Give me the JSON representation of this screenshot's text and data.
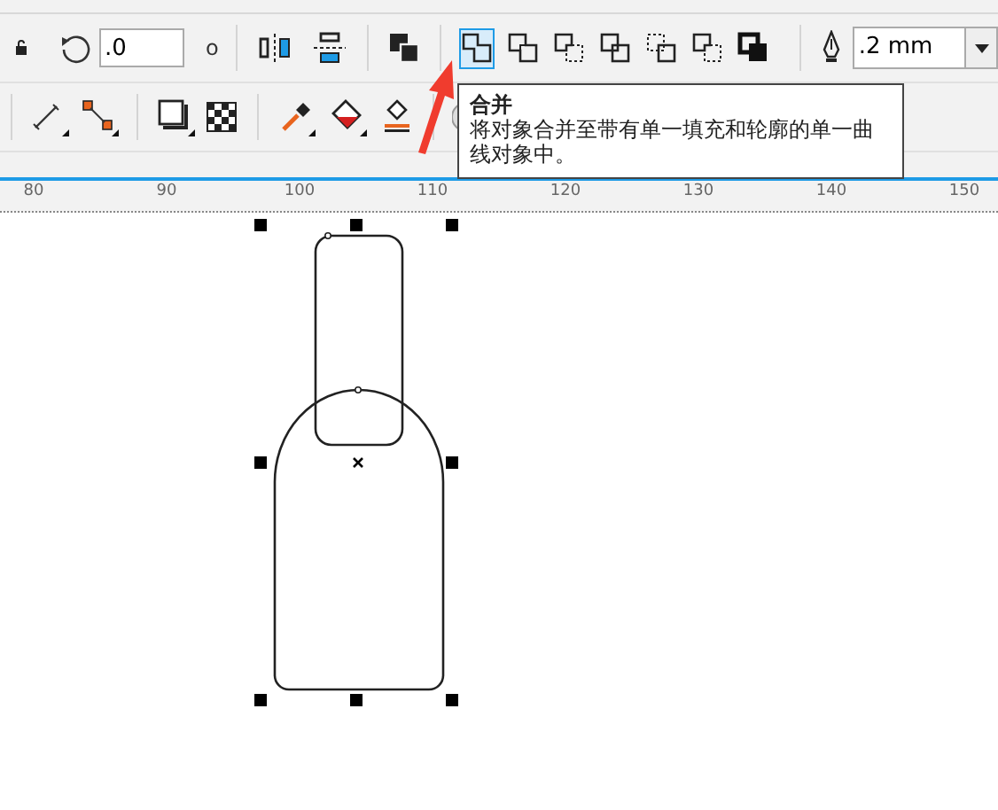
{
  "property_bar": {
    "rotation_value": ".0",
    "degree_symbol": "o",
    "shaping_buttons": [
      {
        "kind": "combine",
        "selected": true
      },
      {
        "kind": "weld",
        "selected": false
      },
      {
        "kind": "trim",
        "selected": false
      },
      {
        "kind": "intersect",
        "selected": false
      },
      {
        "kind": "simplify",
        "selected": false
      },
      {
        "kind": "front_minus_back",
        "selected": false
      },
      {
        "kind": "boundary",
        "selected": false
      }
    ],
    "outline_width": ".2 mm"
  },
  "tooltip": {
    "title": "合并",
    "text": "将对象合并至带有单一填充和轮廓的单一曲线对象中。"
  },
  "ruler": {
    "labels": [
      "80",
      "90",
      "100",
      "110",
      "120",
      "130",
      "140",
      "150"
    ]
  }
}
